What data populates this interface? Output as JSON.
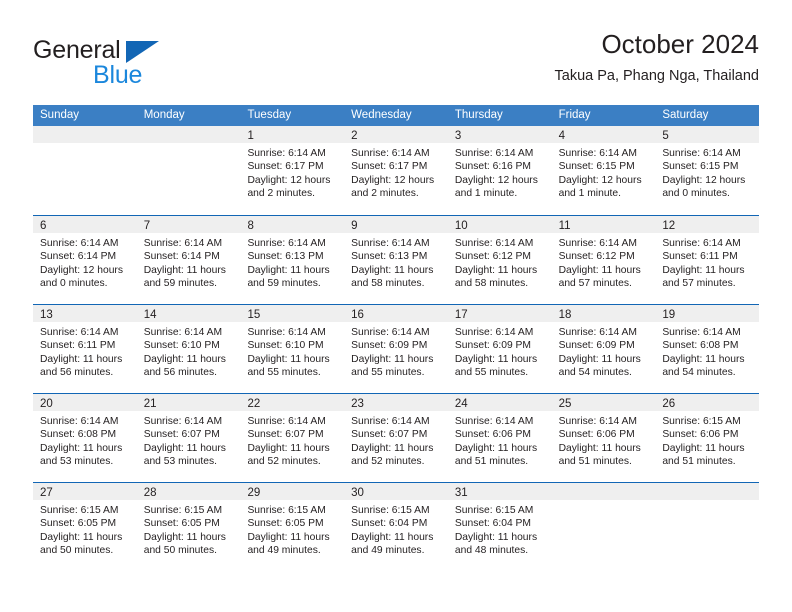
{
  "logo": {
    "word_top": "General",
    "word_bottom": "Blue",
    "triangle_color": "#1266b5",
    "bottom_color": "#1b87dc"
  },
  "header": {
    "title": "October 2024",
    "subtitle": "Takua Pa, Phang Nga, Thailand"
  },
  "calendar": {
    "header_bg": "#3b7fc4",
    "day_band_bg": "#efefef",
    "week_divider_color": "#1266b5",
    "weekdays": [
      "Sunday",
      "Monday",
      "Tuesday",
      "Wednesday",
      "Thursday",
      "Friday",
      "Saturday"
    ],
    "weeks": [
      [
        {
          "day": ""
        },
        {
          "day": ""
        },
        {
          "day": "1",
          "sunrise": "Sunrise: 6:14 AM",
          "sunset": "Sunset: 6:17 PM",
          "daylight1": "Daylight: 12 hours",
          "daylight2": "and 2 minutes."
        },
        {
          "day": "2",
          "sunrise": "Sunrise: 6:14 AM",
          "sunset": "Sunset: 6:17 PM",
          "daylight1": "Daylight: 12 hours",
          "daylight2": "and 2 minutes."
        },
        {
          "day": "3",
          "sunrise": "Sunrise: 6:14 AM",
          "sunset": "Sunset: 6:16 PM",
          "daylight1": "Daylight: 12 hours",
          "daylight2": "and 1 minute."
        },
        {
          "day": "4",
          "sunrise": "Sunrise: 6:14 AM",
          "sunset": "Sunset: 6:15 PM",
          "daylight1": "Daylight: 12 hours",
          "daylight2": "and 1 minute."
        },
        {
          "day": "5",
          "sunrise": "Sunrise: 6:14 AM",
          "sunset": "Sunset: 6:15 PM",
          "daylight1": "Daylight: 12 hours",
          "daylight2": "and 0 minutes."
        }
      ],
      [
        {
          "day": "6",
          "sunrise": "Sunrise: 6:14 AM",
          "sunset": "Sunset: 6:14 PM",
          "daylight1": "Daylight: 12 hours",
          "daylight2": "and 0 minutes."
        },
        {
          "day": "7",
          "sunrise": "Sunrise: 6:14 AM",
          "sunset": "Sunset: 6:14 PM",
          "daylight1": "Daylight: 11 hours",
          "daylight2": "and 59 minutes."
        },
        {
          "day": "8",
          "sunrise": "Sunrise: 6:14 AM",
          "sunset": "Sunset: 6:13 PM",
          "daylight1": "Daylight: 11 hours",
          "daylight2": "and 59 minutes."
        },
        {
          "day": "9",
          "sunrise": "Sunrise: 6:14 AM",
          "sunset": "Sunset: 6:13 PM",
          "daylight1": "Daylight: 11 hours",
          "daylight2": "and 58 minutes."
        },
        {
          "day": "10",
          "sunrise": "Sunrise: 6:14 AM",
          "sunset": "Sunset: 6:12 PM",
          "daylight1": "Daylight: 11 hours",
          "daylight2": "and 58 minutes."
        },
        {
          "day": "11",
          "sunrise": "Sunrise: 6:14 AM",
          "sunset": "Sunset: 6:12 PM",
          "daylight1": "Daylight: 11 hours",
          "daylight2": "and 57 minutes."
        },
        {
          "day": "12",
          "sunrise": "Sunrise: 6:14 AM",
          "sunset": "Sunset: 6:11 PM",
          "daylight1": "Daylight: 11 hours",
          "daylight2": "and 57 minutes."
        }
      ],
      [
        {
          "day": "13",
          "sunrise": "Sunrise: 6:14 AM",
          "sunset": "Sunset: 6:11 PM",
          "daylight1": "Daylight: 11 hours",
          "daylight2": "and 56 minutes."
        },
        {
          "day": "14",
          "sunrise": "Sunrise: 6:14 AM",
          "sunset": "Sunset: 6:10 PM",
          "daylight1": "Daylight: 11 hours",
          "daylight2": "and 56 minutes."
        },
        {
          "day": "15",
          "sunrise": "Sunrise: 6:14 AM",
          "sunset": "Sunset: 6:10 PM",
          "daylight1": "Daylight: 11 hours",
          "daylight2": "and 55 minutes."
        },
        {
          "day": "16",
          "sunrise": "Sunrise: 6:14 AM",
          "sunset": "Sunset: 6:09 PM",
          "daylight1": "Daylight: 11 hours",
          "daylight2": "and 55 minutes."
        },
        {
          "day": "17",
          "sunrise": "Sunrise: 6:14 AM",
          "sunset": "Sunset: 6:09 PM",
          "daylight1": "Daylight: 11 hours",
          "daylight2": "and 55 minutes."
        },
        {
          "day": "18",
          "sunrise": "Sunrise: 6:14 AM",
          "sunset": "Sunset: 6:09 PM",
          "daylight1": "Daylight: 11 hours",
          "daylight2": "and 54 minutes."
        },
        {
          "day": "19",
          "sunrise": "Sunrise: 6:14 AM",
          "sunset": "Sunset: 6:08 PM",
          "daylight1": "Daylight: 11 hours",
          "daylight2": "and 54 minutes."
        }
      ],
      [
        {
          "day": "20",
          "sunrise": "Sunrise: 6:14 AM",
          "sunset": "Sunset: 6:08 PM",
          "daylight1": "Daylight: 11 hours",
          "daylight2": "and 53 minutes."
        },
        {
          "day": "21",
          "sunrise": "Sunrise: 6:14 AM",
          "sunset": "Sunset: 6:07 PM",
          "daylight1": "Daylight: 11 hours",
          "daylight2": "and 53 minutes."
        },
        {
          "day": "22",
          "sunrise": "Sunrise: 6:14 AM",
          "sunset": "Sunset: 6:07 PM",
          "daylight1": "Daylight: 11 hours",
          "daylight2": "and 52 minutes."
        },
        {
          "day": "23",
          "sunrise": "Sunrise: 6:14 AM",
          "sunset": "Sunset: 6:07 PM",
          "daylight1": "Daylight: 11 hours",
          "daylight2": "and 52 minutes."
        },
        {
          "day": "24",
          "sunrise": "Sunrise: 6:14 AM",
          "sunset": "Sunset: 6:06 PM",
          "daylight1": "Daylight: 11 hours",
          "daylight2": "and 51 minutes."
        },
        {
          "day": "25",
          "sunrise": "Sunrise: 6:14 AM",
          "sunset": "Sunset: 6:06 PM",
          "daylight1": "Daylight: 11 hours",
          "daylight2": "and 51 minutes."
        },
        {
          "day": "26",
          "sunrise": "Sunrise: 6:15 AM",
          "sunset": "Sunset: 6:06 PM",
          "daylight1": "Daylight: 11 hours",
          "daylight2": "and 51 minutes."
        }
      ],
      [
        {
          "day": "27",
          "sunrise": "Sunrise: 6:15 AM",
          "sunset": "Sunset: 6:05 PM",
          "daylight1": "Daylight: 11 hours",
          "daylight2": "and 50 minutes."
        },
        {
          "day": "28",
          "sunrise": "Sunrise: 6:15 AM",
          "sunset": "Sunset: 6:05 PM",
          "daylight1": "Daylight: 11 hours",
          "daylight2": "and 50 minutes."
        },
        {
          "day": "29",
          "sunrise": "Sunrise: 6:15 AM",
          "sunset": "Sunset: 6:05 PM",
          "daylight1": "Daylight: 11 hours",
          "daylight2": "and 49 minutes."
        },
        {
          "day": "30",
          "sunrise": "Sunrise: 6:15 AM",
          "sunset": "Sunset: 6:04 PM",
          "daylight1": "Daylight: 11 hours",
          "daylight2": "and 49 minutes."
        },
        {
          "day": "31",
          "sunrise": "Sunrise: 6:15 AM",
          "sunset": "Sunset: 6:04 PM",
          "daylight1": "Daylight: 11 hours",
          "daylight2": "and 48 minutes."
        },
        {
          "day": ""
        },
        {
          "day": ""
        }
      ]
    ]
  }
}
